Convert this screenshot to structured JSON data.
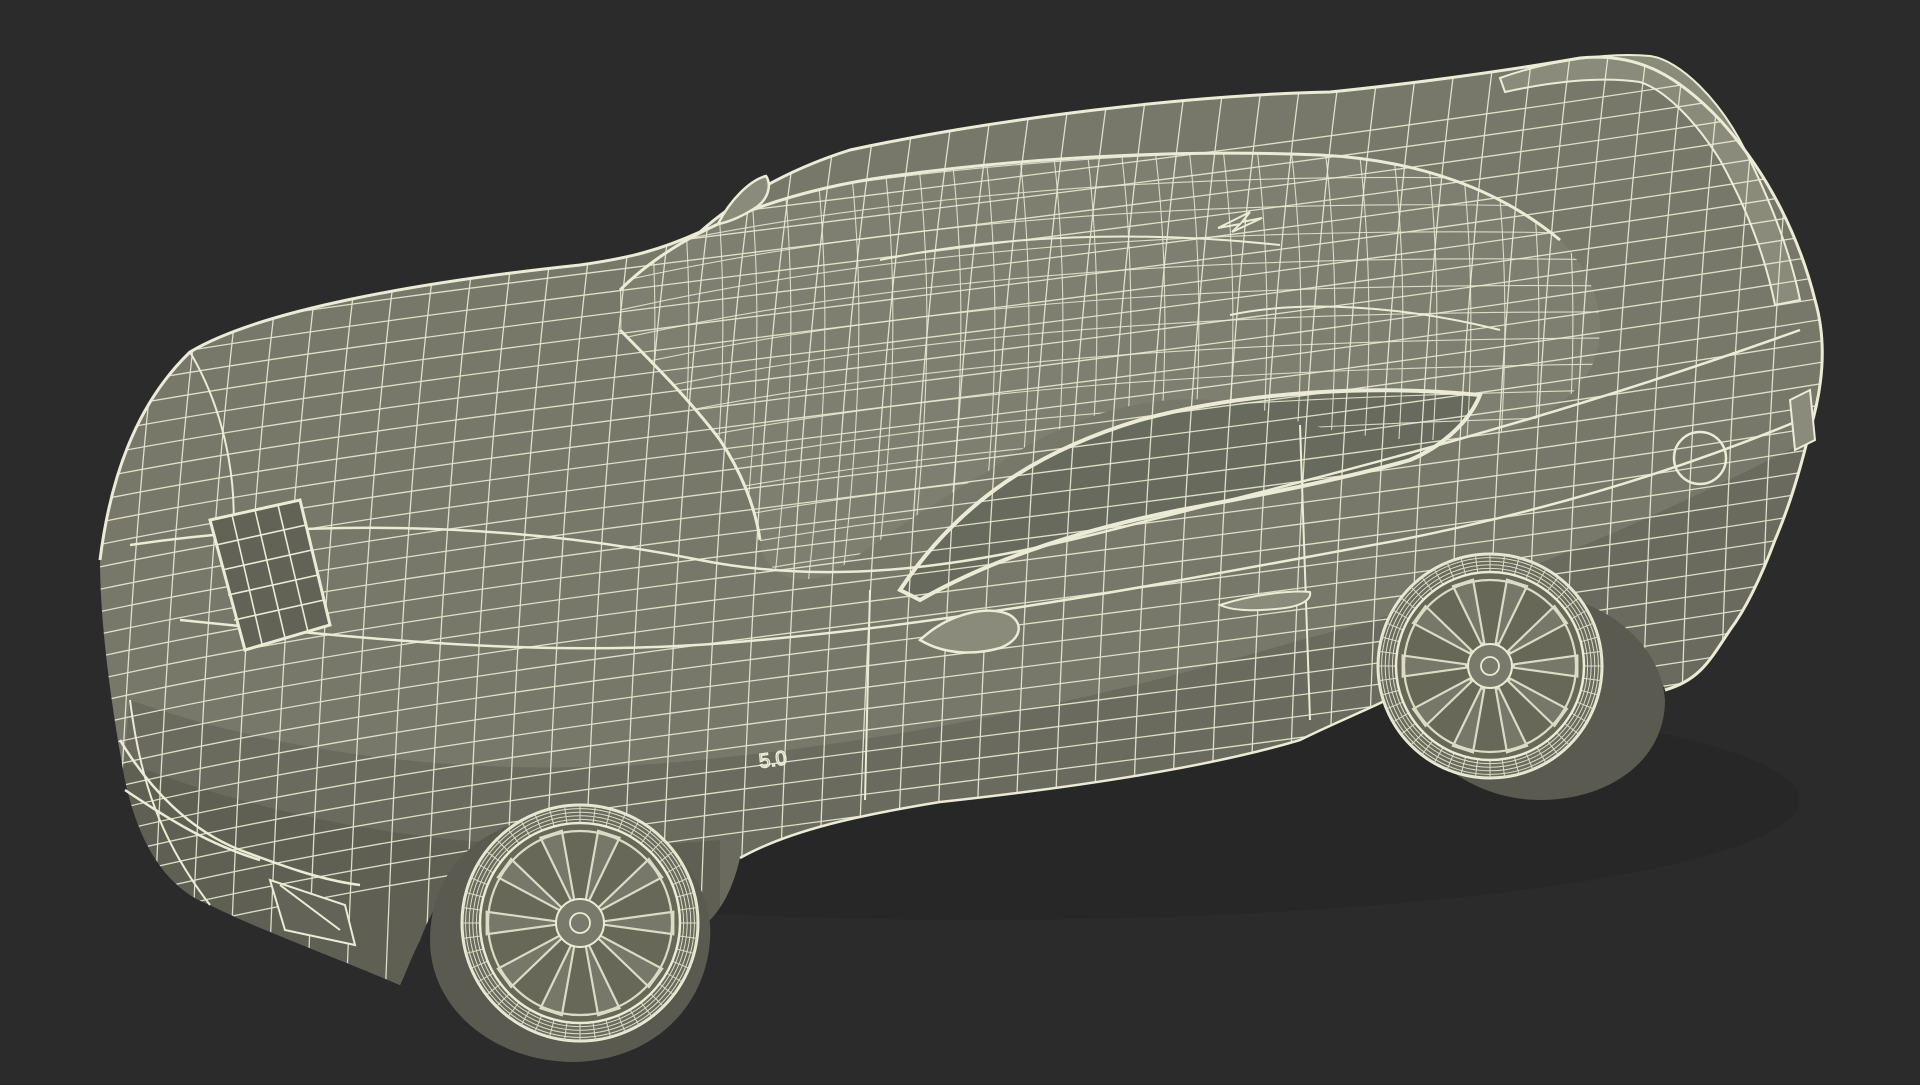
{
  "scene": {
    "subject": "wireframe-car",
    "background_color": "#2b2b2b",
    "body_color": "#77776a",
    "body_dark_color": "#616156",
    "body_light_color": "#8b8b7c",
    "wire_color": "#ecebd6",
    "wheel_color": "#dcdcc6",
    "fender_badge": "5.0"
  }
}
